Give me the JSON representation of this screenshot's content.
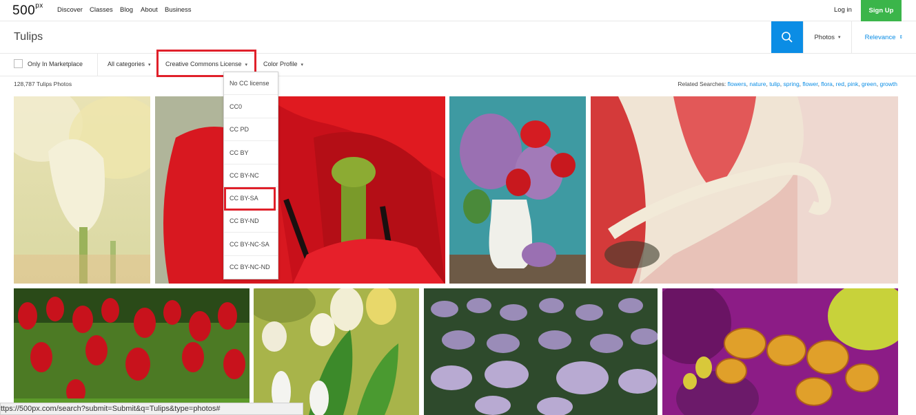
{
  "nav": {
    "logo": "500",
    "logo_sup": "px",
    "links": [
      "Discover",
      "Classes",
      "Blog",
      "About",
      "Business"
    ],
    "login": "Log in",
    "signup": "Sign Up"
  },
  "search": {
    "query": "Tulips",
    "type_label": "Photos",
    "sort_label": "Relevance",
    "search_icon": "search-icon"
  },
  "filters": {
    "marketplace_label": "Only In Marketplace",
    "categories": "All categories",
    "license": "Creative Commons License",
    "color": "Color Profile"
  },
  "license_options": [
    "No CC license",
    "CC0",
    "CC PD",
    "CC BY",
    "CC BY-NC",
    "CC BY-SA",
    "CC BY-ND",
    "CC BY-NC-SA",
    "CC BY-NC-ND"
  ],
  "results": {
    "count": "128,787 Tulips Photos",
    "related_label": "Related Searches:",
    "related": [
      "flowers",
      "nature",
      "tulip",
      "spring",
      "flower",
      "flora",
      "red",
      "pink",
      "green",
      "growth"
    ]
  },
  "status_url": "ttps://500px.com/search?submit=Submit&q=Tulips&type=photos#",
  "colors": {
    "accent_blue": "#0b8de5",
    "signup_green": "#3bb54a",
    "highlight_red": "#e0202a"
  }
}
